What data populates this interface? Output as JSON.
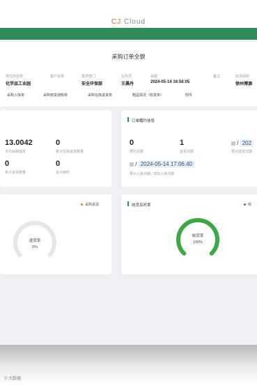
{
  "brand": {
    "prefix": "CJ",
    "suffix": "Cloud"
  },
  "page_title": "采购订单全貌",
  "fields": [
    {
      "label": "供应商名称",
      "value": "化学品工业园"
    },
    {
      "label": "客户名称",
      "value": ""
    },
    {
      "label": "需求部门",
      "value": "安全环保部"
    },
    {
      "label": "业务员",
      "value": "王晨丹"
    },
    {
      "label": "采期",
      "value": "2024-05-14 16:56:05"
    },
    {
      "label": "备注",
      "value": ""
    },
    {
      "label": "收货组织",
      "value": "徐州博源"
    }
  ],
  "tabs": [
    "采购入库单",
    "采购到货通知单",
    "采购在库退货单",
    "赔品情况（收发单）",
    "附件"
  ],
  "stats": {
    "avg_cost": "13.0042",
    "avg_cost_label": "平均采购成本",
    "cum_return": "0",
    "cum_return_label": "累计在库退货数量",
    "cum_quality": "0",
    "cum_quality_label": "累计退货数量",
    "total_hours": "0",
    "total_hours_label": "总计耗时"
  },
  "delivery": {
    "section_title": "订单履约信息",
    "booking_count": "0",
    "booking_label": "预约次数",
    "return_count": "1",
    "return_label": "退货次数",
    "plan_date_prefix": "202",
    "plan_label": "预计送货日期",
    "separator": "/",
    "actual_date": "2024-05-14 17:06:40",
    "actual_label": "预计入库日期 / 实际入库日期"
  },
  "return_rate": {
    "legend": "采购退货",
    "gauge_label": "退货率",
    "gauge_value": "0%",
    "rate": 0,
    "color": "#e67e22"
  },
  "receive_rate": {
    "section_title": "收货及时率",
    "legend": "收",
    "gauge_label": "收货率",
    "gauge_value": "100%",
    "rate": 1,
    "color": "#3aa843"
  },
  "watermark": "© 大数据"
}
